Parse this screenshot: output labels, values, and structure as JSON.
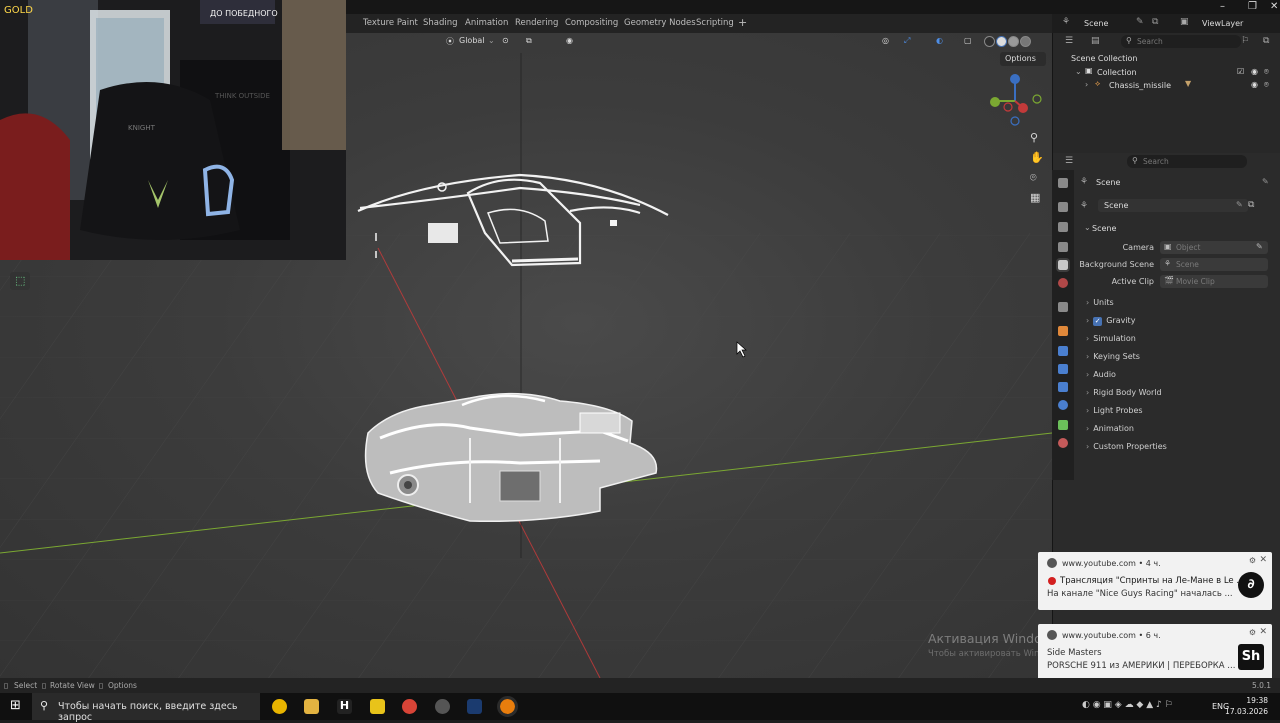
{
  "workspace_tabs": [
    "Texture Paint",
    "Shading",
    "Animation",
    "Rendering",
    "Compositing",
    "Geometry Nodes",
    "Scripting",
    "+"
  ],
  "scene_selector": "Scene",
  "viewlayer_selector": "ViewLayer",
  "viewport_header": {
    "orientation": "Global",
    "options": "Options"
  },
  "outliner": {
    "search_placeholder": "Search",
    "root": "Scene Collection",
    "collection": "Collection",
    "object": "Chassis_missile"
  },
  "properties": {
    "search_placeholder": "Search",
    "breadcrumb": "Scene",
    "datablock": "Scene",
    "panel_title": "Scene",
    "fields": [
      {
        "label": "Camera",
        "placeholder": "Object"
      },
      {
        "label": "Background Scene",
        "placeholder": "Scene"
      },
      {
        "label": "Active Clip",
        "placeholder": "Movie Clip"
      }
    ],
    "subpanels": [
      "Units",
      "Gravity",
      "Simulation",
      "Keying Sets",
      "Audio",
      "Rigid Body World",
      "Light Probes",
      "Animation",
      "Custom Properties"
    ],
    "gravity_checked": true
  },
  "webcam": {
    "sign_text": "ДО ПОБЕДНОГО",
    "gold_text": "GOLD",
    "chair_brand": "KNIGHT",
    "poster_text": "THINK OUTSIDE"
  },
  "notifications": [
    {
      "source": "www.youtube.com",
      "age": "• 4 ч.",
      "title": "Трансляция \"Спринты на Ле-Мане в Le ...",
      "body": "На канале \"Nice Guys Racing\" началась ...",
      "live": true
    },
    {
      "source": "www.youtube.com",
      "age": "• 6 ч.",
      "title": "Side Masters",
      "body": "PORSCHE 911 из АМЕРИКИ | ПЕРЕБОРКА ...",
      "live": false
    }
  ],
  "activation_watermark": {
    "title": "Активация Windows",
    "body": "Чтобы активировать Windows, перейдите в раздел \"Параметры\"."
  },
  "statusbar": {
    "select": "Select",
    "rotate": "Rotate View",
    "options": "Options",
    "version": "5.0.1"
  },
  "taskbar": {
    "search_placeholder": "Чтобы начать поиск, введите здесь запрос",
    "language": "ENG",
    "time": "19:38",
    "date": "17.03.2026"
  },
  "colors": {
    "accent": "#4772b3",
    "x_axis": "#c23a3a",
    "y_axis": "#7ba832",
    "z_axis": "#3a6fc2"
  }
}
